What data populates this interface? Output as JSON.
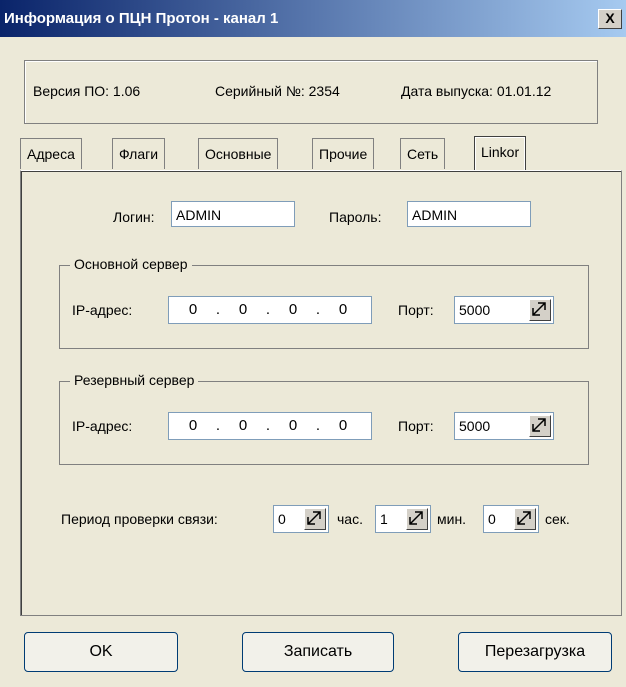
{
  "window": {
    "title": "Информация о ПЦН Протон - канал 1",
    "close_label": "X"
  },
  "info": {
    "version": "Версия ПО: 1.06",
    "serial": "Серийный №: 2354",
    "release_date": "Дата выпуска: 01.01.12"
  },
  "tabs": [
    {
      "label": "Адреса"
    },
    {
      "label": "Флаги"
    },
    {
      "label": "Основные"
    },
    {
      "label": "Прочие"
    },
    {
      "label": "Сеть"
    },
    {
      "label": "Linkor",
      "active": true
    }
  ],
  "linkor": {
    "login_label": "Логин:",
    "login_value": "ADMIN",
    "password_label": "Пароль:",
    "password_value": "ADMIN",
    "primary": {
      "title": "Основной сервер",
      "ip_label": "IP-адрес:",
      "ip_octets": [
        "0",
        "0",
        "0",
        "0"
      ],
      "port_label": "Порт:",
      "port_value": "5000"
    },
    "backup": {
      "title": "Резервный сервер",
      "ip_label": "IP-адрес:",
      "ip_octets": [
        "0",
        "0",
        "0",
        "0"
      ],
      "port_label": "Порт:",
      "port_value": "5000"
    },
    "period": {
      "label": "Период проверки связи:",
      "hours_value": "0",
      "hours_unit": "час.",
      "minutes_value": "1",
      "minutes_unit": "мин.",
      "seconds_value": "0",
      "seconds_unit": "сек."
    }
  },
  "buttons": {
    "ok": "OK",
    "write": "Записать",
    "reboot": "Перезагрузка"
  }
}
